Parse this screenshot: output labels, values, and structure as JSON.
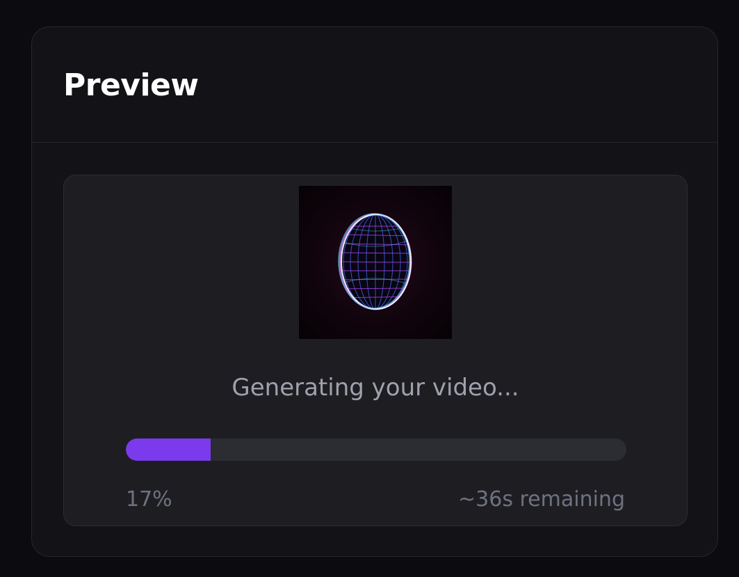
{
  "panel": {
    "title": "Preview"
  },
  "preview": {
    "thumbnail": "wireframe-orb-video-frame",
    "status": "Generating your video...",
    "progress_fraction": 0.17,
    "percent_label": "17%",
    "remaining_label": "~36s remaining"
  },
  "colors": {
    "accent": "#7c3aed",
    "track": "#2c2c33",
    "muted_text": "#6e7280"
  }
}
